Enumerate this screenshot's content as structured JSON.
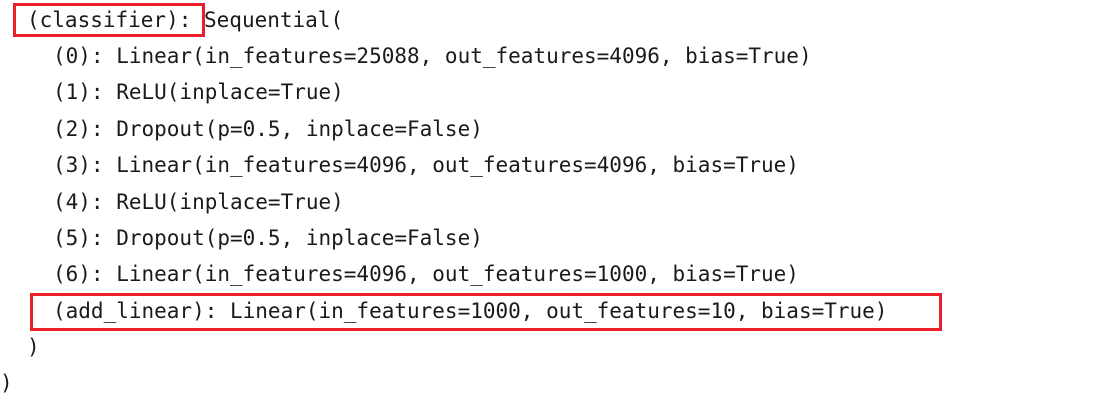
{
  "output": {
    "header_label": "(classifier):",
    "header_rest": " Sequential(",
    "layers": [
      "(0): Linear(in_features=25088, out_features=4096, bias=True)",
      "(1): ReLU(inplace=True)",
      "(2): Dropout(p=0.5, inplace=False)",
      "(3): Linear(in_features=4096, out_features=4096, bias=True)",
      "(4): ReLU(inplace=True)",
      "(5): Dropout(p=0.5, inplace=False)",
      "(6): Linear(in_features=4096, out_features=1000, bias=True)"
    ],
    "added_layer": "(add_linear): Linear(in_features=1000, out_features=10, bias=True)",
    "close_inner": ")",
    "close_outer": ")"
  },
  "colors": {
    "highlight": "#e8202a",
    "text": "#1a1a1a",
    "background": "#ffffff"
  }
}
